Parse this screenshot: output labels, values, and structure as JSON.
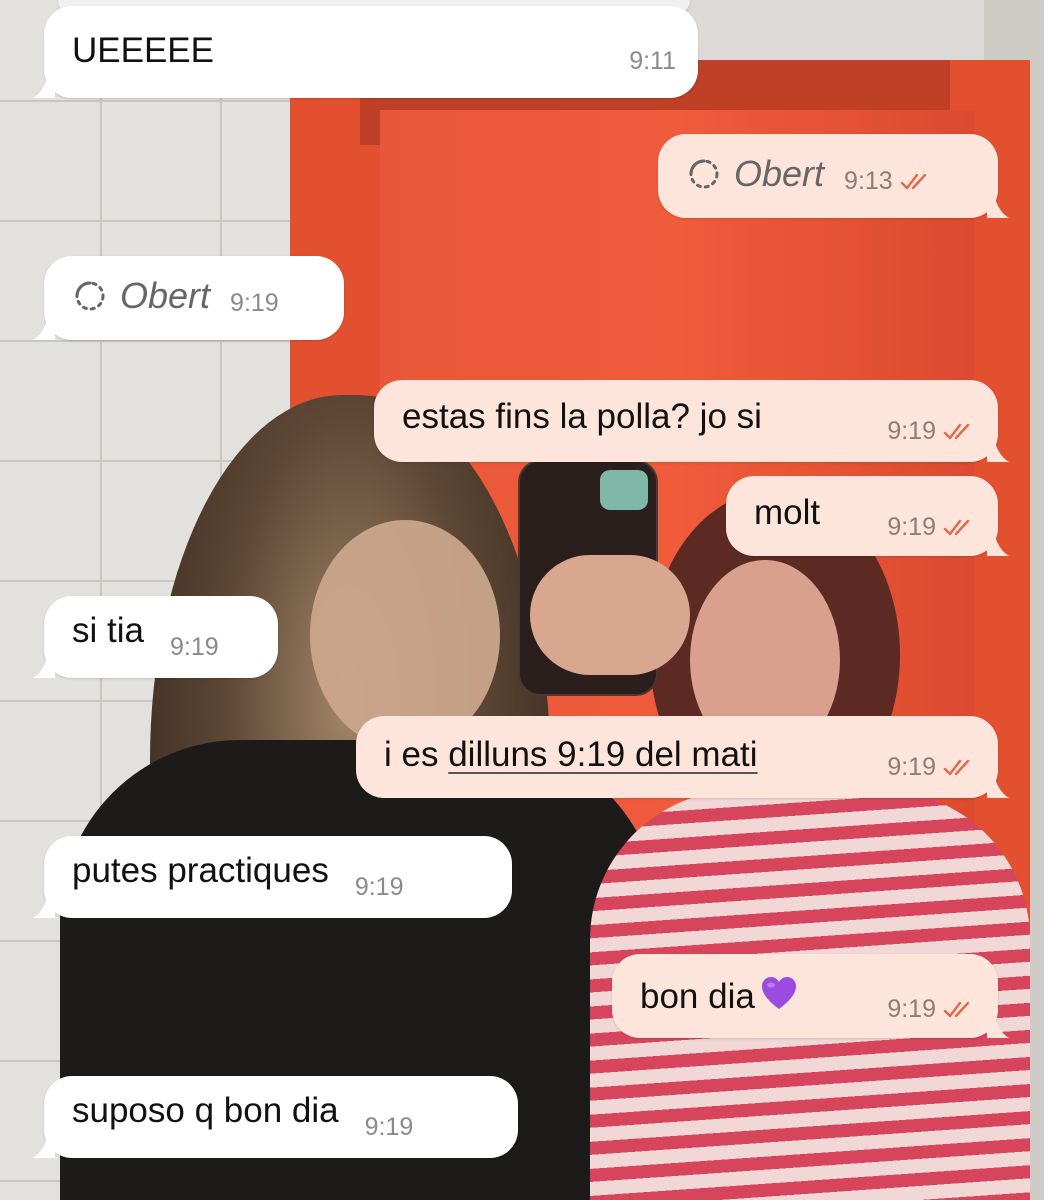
{
  "messages": [
    {
      "direction": "incoming",
      "text": "UEEEEE",
      "time": "9:11"
    },
    {
      "direction": "outgoing",
      "kind": "view_once",
      "label": "Obert",
      "time": "9:13",
      "status": "read"
    },
    {
      "direction": "incoming",
      "kind": "view_once",
      "label": "Obert",
      "time": "9:19"
    },
    {
      "direction": "outgoing",
      "text": "estas fins la polla? jo si",
      "time": "9:19",
      "status": "read"
    },
    {
      "direction": "outgoing",
      "text": "molt",
      "time": "9:19",
      "status": "read"
    },
    {
      "direction": "incoming",
      "text": "si tia",
      "time": "9:19"
    },
    {
      "direction": "outgoing",
      "text_prefix": "i es ",
      "text_link": "dilluns 9:19 del mati",
      "time": "9:19",
      "status": "read"
    },
    {
      "direction": "incoming",
      "text": "putes practiques",
      "time": "9:19"
    },
    {
      "direction": "outgoing",
      "text": "bon dia",
      "emoji": "purple-heart",
      "time": "9:19",
      "status": "read"
    },
    {
      "direction": "incoming",
      "text": "suposo q bon dia",
      "time": "9:19"
    }
  ],
  "colors": {
    "incoming_bubble": "#ffffff",
    "outgoing_bubble": "#fde5dc",
    "read_ticks": "#e06a4d",
    "heart": "#9b4be0"
  },
  "icons": {
    "view_once": "view-once-opened-icon",
    "read_status": "double-check-icon",
    "emoji": "purple-heart-icon"
  }
}
